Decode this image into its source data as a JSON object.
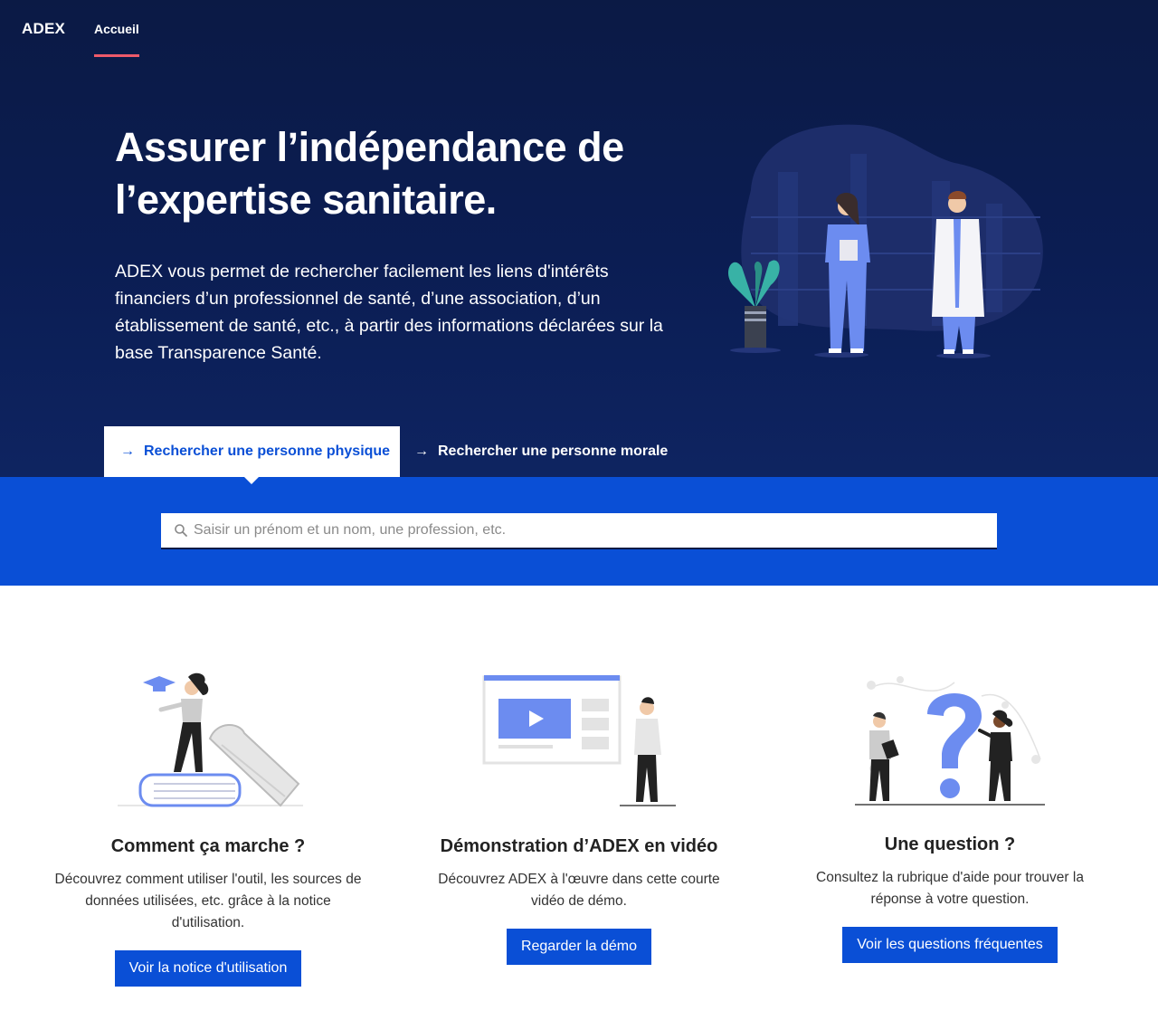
{
  "nav": {
    "brand": "ADEX",
    "links": [
      {
        "label": "Accueil",
        "active": true
      }
    ]
  },
  "hero": {
    "title": "Assurer l’indépendance de l’expertise sanitaire.",
    "description": "ADEX vous permet de rechercher facilement les liens d'intérêts financiers d’un professionnel de santé, d’une association, d’un établissement de santé, etc., à partir des informations déclarées sur la base Transparence Santé."
  },
  "tabs": [
    {
      "label": "Rechercher une personne physique",
      "active": true,
      "icon": "arrow-right-icon"
    },
    {
      "label": "Rechercher une personne morale",
      "active": false,
      "icon": "arrow-right-icon"
    }
  ],
  "search": {
    "placeholder": "Saisir un prénom et un nom, une profession, etc.",
    "value": "",
    "icon": "search-icon"
  },
  "cards": [
    {
      "title": "Comment ça marche ?",
      "text": "Découvrez comment utiliser l'outil, les sources de données utilisées, etc. grâce à la notice d'utilisation.",
      "button": "Voir la notice d'utilisation",
      "illustration": "student-books-illustration"
    },
    {
      "title": "Démonstration d’ADEX en vidéo",
      "text": "Découvrez ADEX à l'œuvre dans cette courte vidéo de démo.",
      "button": "Regarder la démo",
      "illustration": "video-player-illustration"
    },
    {
      "title": "Une question ?",
      "text": "Consultez la rubrique d'aide pour trouver la réponse à votre question.",
      "button": "Voir les questions fréquentes",
      "illustration": "question-mark-illustration"
    }
  ],
  "colors": {
    "hero_bg": "#0b1d53",
    "accent_blue": "#0a4fd6",
    "nav_underline": "#ef5a6a",
    "illustration_blue": "#6c8cf0"
  }
}
